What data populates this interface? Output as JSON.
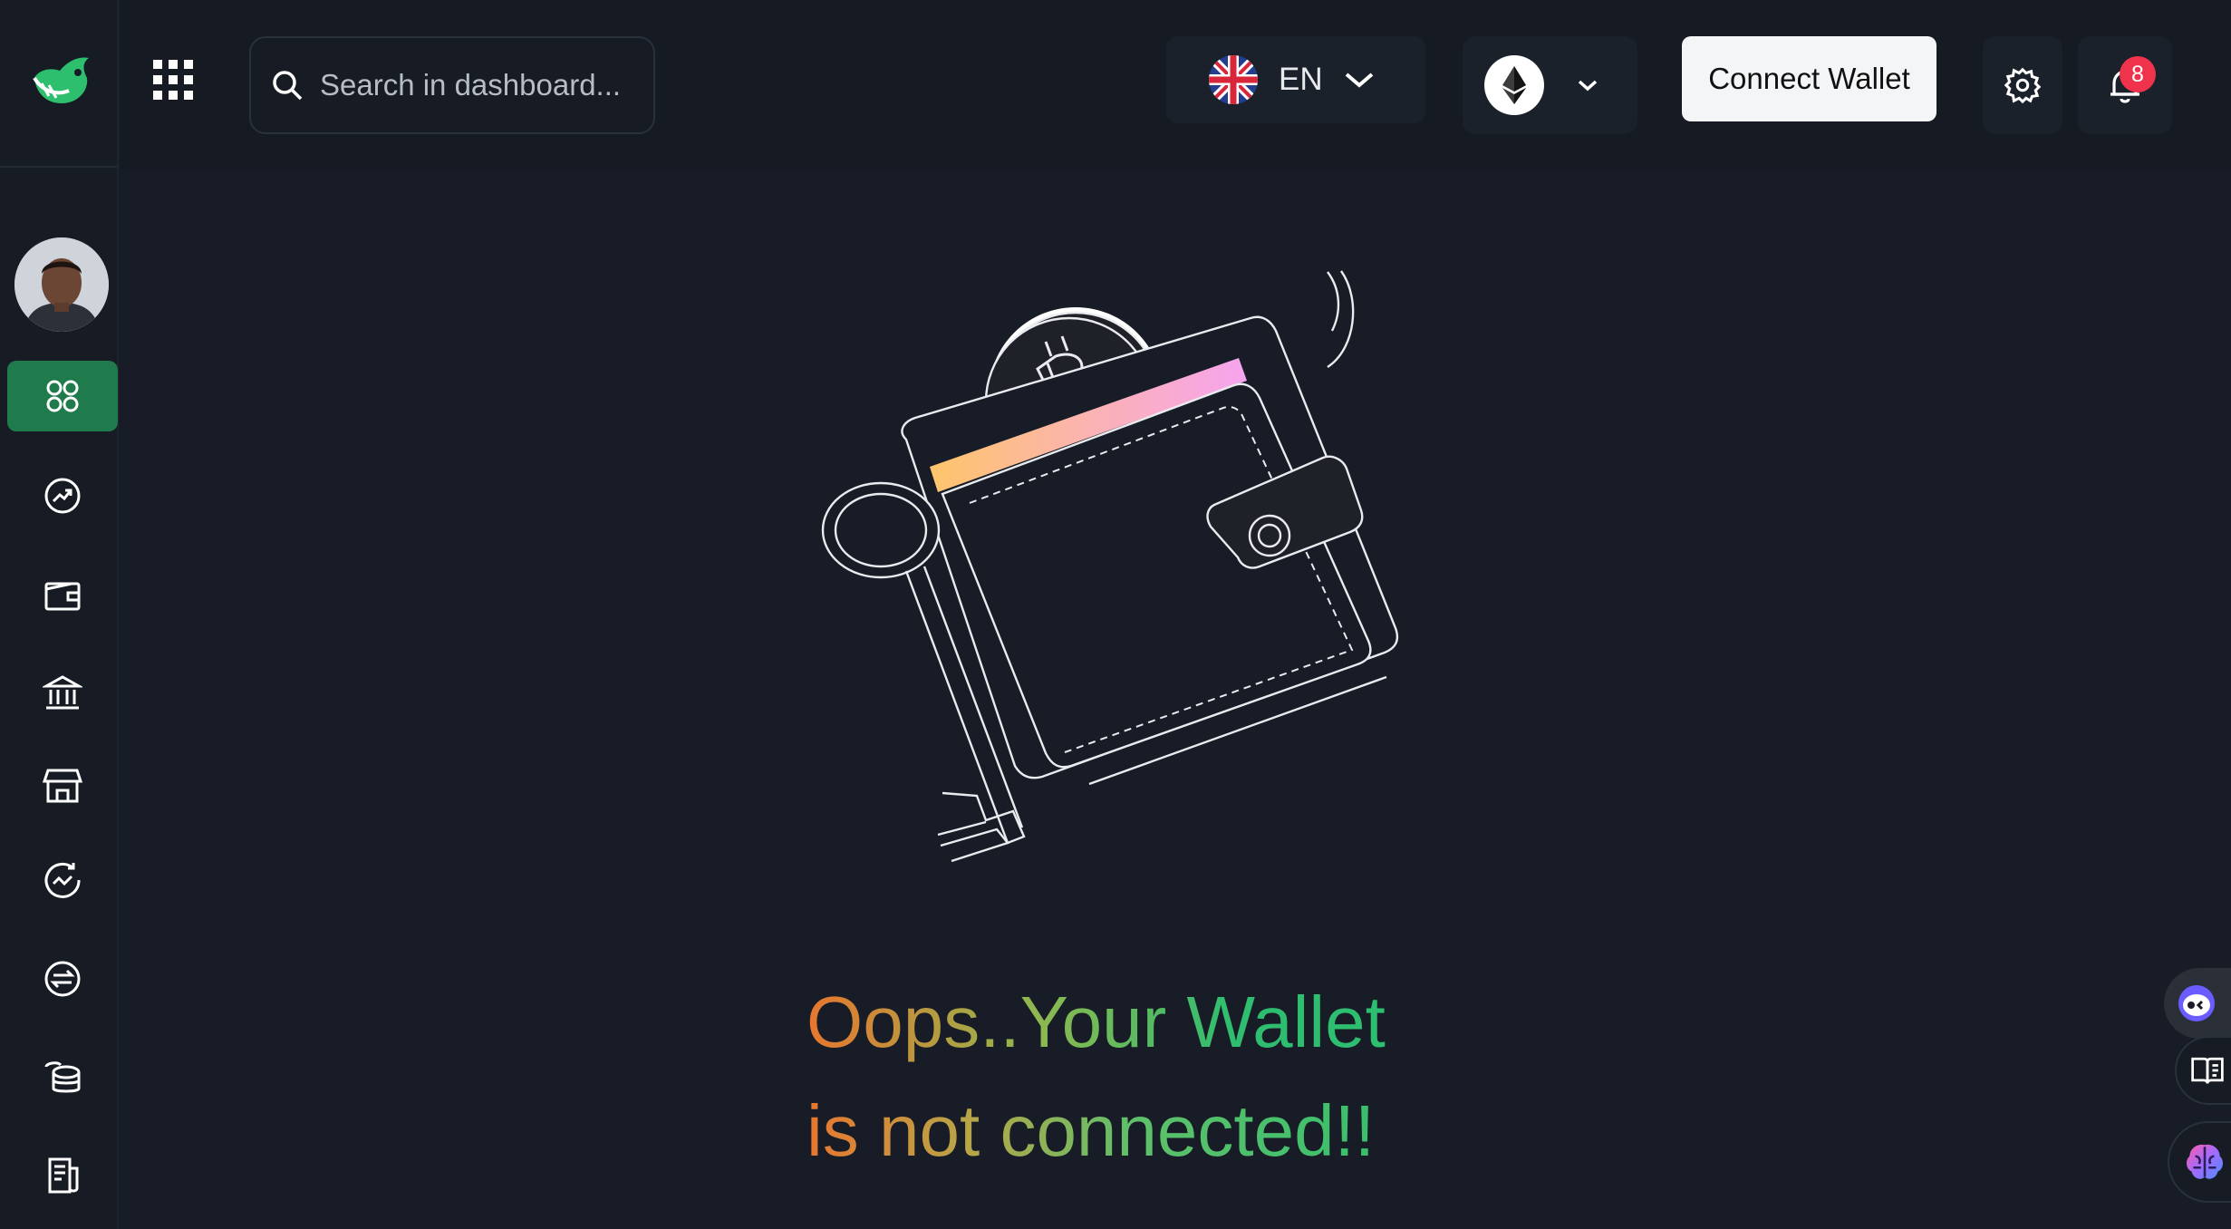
{
  "sidebar": {
    "logo": "whale-logo-icon",
    "avatar": "user-avatar",
    "items": [
      {
        "name": "dashboard",
        "icon": "grid-four-circles-icon",
        "active": true
      },
      {
        "name": "analytics",
        "icon": "trend-up-icon",
        "active": false
      },
      {
        "name": "wallet",
        "icon": "wallet-icon",
        "active": false
      },
      {
        "name": "bank",
        "icon": "bank-icon",
        "active": false
      },
      {
        "name": "store",
        "icon": "store-icon",
        "active": false
      },
      {
        "name": "market",
        "icon": "chart-refresh-icon",
        "active": false
      },
      {
        "name": "swap",
        "icon": "swap-icon",
        "active": false
      },
      {
        "name": "coins",
        "icon": "coins-stack-icon",
        "active": false
      },
      {
        "name": "reports",
        "icon": "document-icon",
        "active": false
      }
    ]
  },
  "topbar": {
    "search_placeholder": "Search in dashboard...",
    "language": "EN",
    "language_flag": "uk-flag-icon",
    "chain_icon": "ethereum-icon",
    "connect_label": "Connect Wallet",
    "notifications_count": "8"
  },
  "main": {
    "headline_line1": "Oops..Your Wallet",
    "headline_line2": "is not connected!!"
  },
  "colors": {
    "background": "#171c26",
    "active_nav": "#1f7a4c",
    "brand_green": "#2dbf6e",
    "badge": "#f0334d"
  }
}
